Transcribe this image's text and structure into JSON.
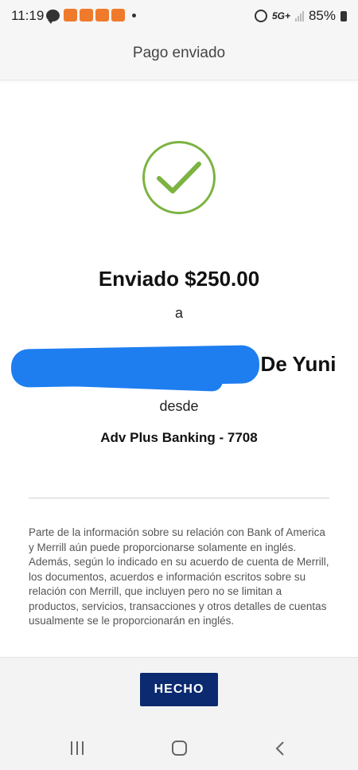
{
  "status_bar": {
    "time": "11:19",
    "network": "5G+",
    "battery": "85%",
    "notification_icons": [
      "chat-icon",
      "app-notification-icon",
      "app-notification-icon",
      "app-notification-icon",
      "app-notification-icon"
    ],
    "status_icons": [
      "alarm-icon",
      "signal-icon",
      "battery-icon"
    ]
  },
  "header": {
    "title": "Pago enviado"
  },
  "confirmation": {
    "icon": "check-circle-icon",
    "icon_color": "#7cb342",
    "amount_text": "Enviado $250.00",
    "to_label": "a",
    "recipient_visible": "De Yuni",
    "from_label": "desde",
    "account": "Adv Plus Banking - 7708"
  },
  "disclaimer": "Parte de la información sobre su relación con Bank of America y Merrill aún puede proporcionarse solamente en inglés. Además, según lo indicado en su acuerdo de cuenta de Merrill, los documentos, acuerdos e información escritos sobre su relación con Merrill, que incluyen pero no se limitan a productos, servicios, transacciones y otros detalles de cuentas usualmente se le proporcionarán en inglés.",
  "footer": {
    "done_label": "HECHO",
    "button_color": "#0b2a6f"
  },
  "nav_bar": {
    "icons": [
      "recent-apps-icon",
      "home-icon",
      "back-icon"
    ]
  },
  "colors": {
    "redaction": "#1e7ef0",
    "background": "#ffffff",
    "header_bg": "#f6f6f6"
  }
}
